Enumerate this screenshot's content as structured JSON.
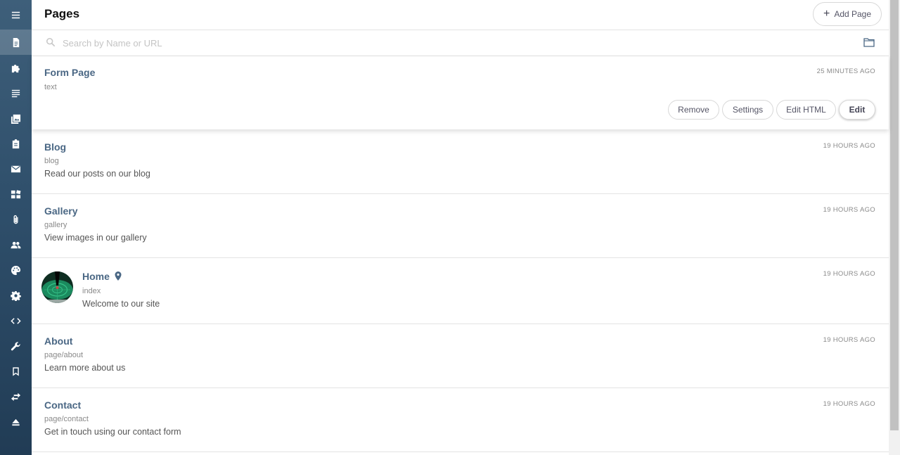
{
  "header": {
    "title": "Pages",
    "add_button": "Add Page"
  },
  "search": {
    "placeholder": "Search by Name or URL",
    "value": ""
  },
  "sidebar": {
    "items": [
      {
        "icon": "menu-icon"
      },
      {
        "icon": "document-icon",
        "active": true
      },
      {
        "icon": "puzzle-icon"
      },
      {
        "icon": "list-icon"
      },
      {
        "icon": "image-icon"
      },
      {
        "icon": "clipboard-icon"
      },
      {
        "icon": "mail-icon"
      },
      {
        "icon": "dashboard-icon"
      },
      {
        "icon": "paperclip-icon"
      },
      {
        "icon": "users-icon"
      },
      {
        "icon": "palette-icon"
      },
      {
        "icon": "gear-icon"
      },
      {
        "icon": "code-icon"
      },
      {
        "icon": "wrench-icon"
      },
      {
        "icon": "bookmark-icon"
      },
      {
        "icon": "transfer-icon"
      },
      {
        "icon": "eject-icon"
      }
    ]
  },
  "pages": [
    {
      "name": "Form Page",
      "slug": "text",
      "description": "",
      "time": "25 MINUTES AGO",
      "actions": [
        "Remove",
        "Settings",
        "Edit HTML",
        "Edit"
      ]
    },
    {
      "name": "Blog",
      "slug": "blog",
      "description": "Read our posts on our blog",
      "time": "19 HOURS AGO"
    },
    {
      "name": "Gallery",
      "slug": "gallery",
      "description": "View images in our gallery",
      "time": "19 HOURS AGO"
    },
    {
      "name": "Home",
      "slug": "index",
      "description": "Welcome to our site",
      "time": "19 HOURS AGO"
    },
    {
      "name": "About",
      "slug": "page/about",
      "description": "Learn more about us",
      "time": "19 HOURS AGO"
    },
    {
      "name": "Contact",
      "slug": "page/contact",
      "description": "Get in touch using our contact form",
      "time": "19 HOURS AGO"
    }
  ]
}
